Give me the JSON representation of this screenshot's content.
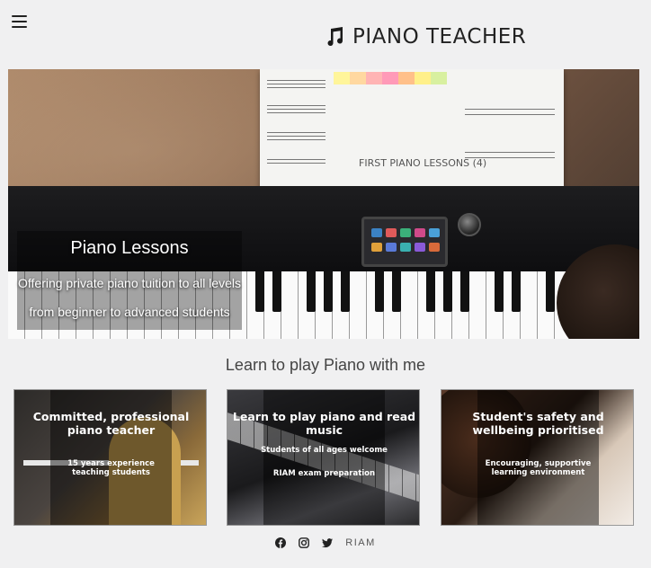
{
  "header": {
    "menu_icon": "hamburger-menu-icon",
    "brand_icon": "music-note-icon",
    "brand_name": "PIANO TEACHER"
  },
  "hero": {
    "title": "Piano Lessons",
    "line1": "Offering private piano tuition to all levels",
    "line2": "from beginner to advanced students",
    "sheet_title": "FIRST PIANO LESSONS (4)"
  },
  "section": {
    "heading": "Learn to play Piano with me"
  },
  "cards": [
    {
      "title": "Committed, professional piano teacher",
      "sub1": "15 years experience",
      "sub2": "teaching students"
    },
    {
      "title": "Learn to play piano and read music",
      "sub1": "Students of all ages welcome",
      "sub2": "RIAM exam preparation"
    },
    {
      "title": "Student's safety and wellbeing prioritised",
      "sub1": "Encouraging, supportive",
      "sub2": "learning environment"
    }
  ],
  "footer": {
    "icons": [
      "facebook-icon",
      "instagram-icon",
      "twitter-icon"
    ],
    "riam_label": "RIAM"
  },
  "colors": {
    "background": "#f0f0f1",
    "text": "#333333"
  }
}
